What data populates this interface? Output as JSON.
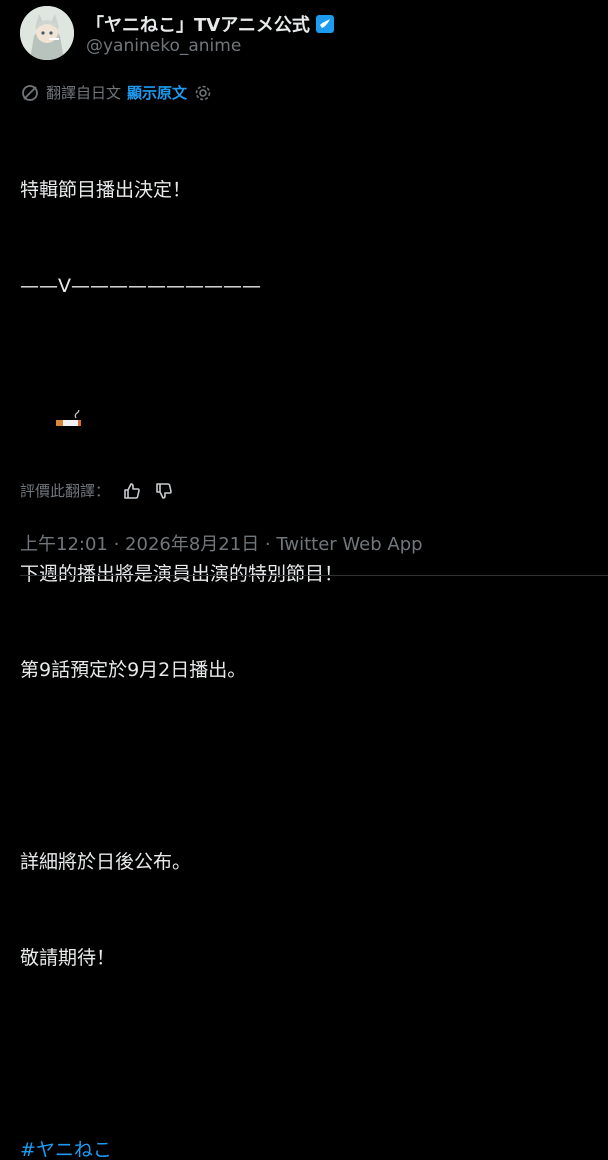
{
  "header": {
    "display_name": "「ヤニねこ」TVアニメ公式",
    "handle": "@yanineko_anime"
  },
  "translation_bar": {
    "translated_from": "翻譯自日文",
    "show_original": "顯示原文"
  },
  "tweet": {
    "lines": [
      "特輯節目播出決定！",
      "⎯⎯V⎯⎯⎯⎯⎯⎯⎯⎯",
      "",
      "",
      "下週的播出將是演員出演的特別節目！",
      "第9話預定於9月2日播出。",
      "",
      "詳細將於日後公布。",
      "敬請期待！",
      "",
      "#ヤニねこ"
    ],
    "dash_line_prefix": "——",
    "dash_line_v": "V",
    "dash_line_suffix": "——————————",
    "hashtag": "#ヤニねこ"
  },
  "rating": {
    "label": "評價此翻譯："
  },
  "meta": {
    "text": "上午12:01 · 2026年8月21日 · Twitter Web App"
  },
  "colors": {
    "background": "#000000",
    "text": "#e7e9ea",
    "muted": "#71767b",
    "accent": "#1d9bf0"
  },
  "icons": {
    "verified": "verified-badge-icon",
    "translate": "translate-icon",
    "settings": "gear-icon",
    "thumb_up": "thumbs-up-icon",
    "thumb_down": "thumbs-down-icon",
    "cigarette": "cigarette-icon"
  }
}
